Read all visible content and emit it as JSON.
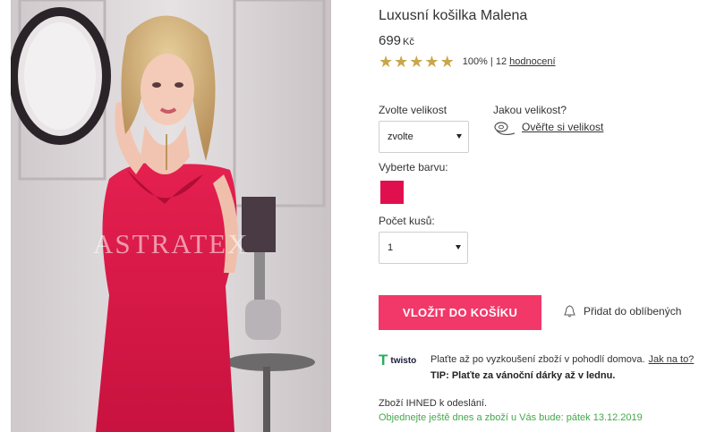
{
  "product": {
    "title": "Luxusní košilka Malena",
    "price": "699",
    "currency": "Kč",
    "watermark": "ASTRATEX",
    "image_alt_icon": "product-photo"
  },
  "rating": {
    "stars": 5,
    "max_stars": 5,
    "percent": "100%",
    "separator": "|",
    "count": "12",
    "reviews_link": "hodnocení"
  },
  "size": {
    "label": "Zvolte velikost",
    "value": "zvolte",
    "help_label": "Jakou velikost?",
    "help_link": "Ověřte si velikost"
  },
  "color": {
    "label": "Vyberte barvu:",
    "swatch": "#e0104f"
  },
  "quantity": {
    "label": "Počet kusů:",
    "value": "1"
  },
  "actions": {
    "add_to_cart": "VLOŽIT DO KOŠÍKU",
    "favorite": "Přidat do oblíbených"
  },
  "twisto": {
    "brand": "twisto",
    "text": "Plaťte až po vyzkoušení zboží v pohodlí domova.",
    "link": "Jak na to?",
    "tip": "TIP: Plaťte za vánoční dárky až v lednu."
  },
  "shipping": {
    "stock": "Zboží IHNED k odeslání.",
    "delivery": "Objednejte ještě dnes a zboží u Vás bude: pátek 13.12.2019"
  },
  "colors": {
    "accent": "#f23869",
    "star": "#c8a64a",
    "success": "#44a84b"
  }
}
